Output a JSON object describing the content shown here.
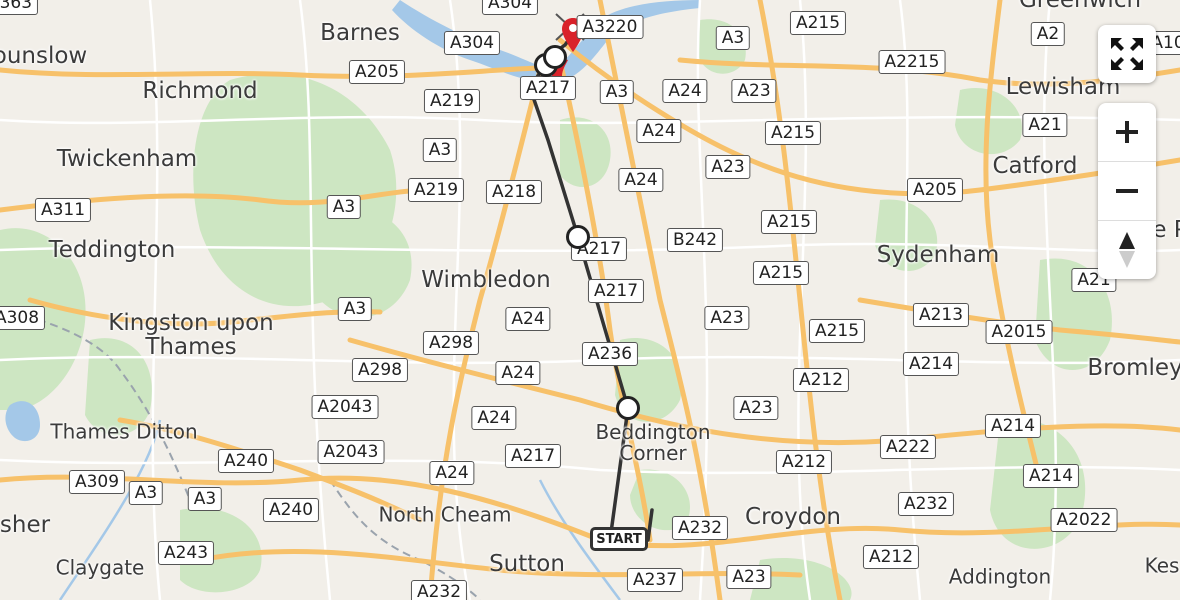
{
  "map": {
    "places": [
      {
        "name": "Barnes",
        "size": "lg"
      },
      {
        "name": "ounslow",
        "size": "lg"
      },
      {
        "name": "Richmond",
        "size": "lg"
      },
      {
        "name": "Twickenham",
        "size": "lg"
      },
      {
        "name": "Teddington",
        "size": "lg"
      },
      {
        "name": "Kingston upon\nThames",
        "size": "lg"
      },
      {
        "name": "Wimbledon",
        "size": "lg"
      },
      {
        "name": "Thames Ditton",
        "size": "sm"
      },
      {
        "name": "North Cheam",
        "size": "sm"
      },
      {
        "name": "Claygate",
        "size": "sm"
      },
      {
        "name": "Sutton",
        "size": "lg"
      },
      {
        "name": "Beddington\nCorner",
        "size": "sm"
      },
      {
        "name": "Croydon",
        "size": "lg"
      },
      {
        "name": "Addington",
        "size": "sm"
      },
      {
        "name": "Kes",
        "size": "sm"
      },
      {
        "name": "Bromley",
        "size": "lg"
      },
      {
        "name": "Sydenham",
        "size": "lg"
      },
      {
        "name": "Catford",
        "size": "lg"
      },
      {
        "name": "Lewisham",
        "size": "lg"
      },
      {
        "name": "Greenwich",
        "size": "lg"
      },
      {
        "name": "sher",
        "size": "lg"
      },
      {
        "name": "e P",
        "size": "lg"
      }
    ],
    "roads": [
      "A304",
      "A3220",
      "A3",
      "A215",
      "A2",
      "A205",
      "A304",
      "A2215",
      "A217",
      "A219",
      "A3",
      "A24",
      "A23",
      "A215",
      "A24",
      "A21",
      "A3",
      "A219",
      "A218",
      "A24",
      "A23",
      "A205",
      "A311",
      "A3",
      "A217",
      "B242",
      "A215",
      "A215",
      "A21",
      "A217",
      "A23",
      "A215",
      "A213",
      "A2015",
      "A308",
      "A3",
      "A24",
      "A236",
      "A298",
      "A298",
      "A24",
      "A212",
      "A214",
      "A2043",
      "A24",
      "A23",
      "A214",
      "A2043",
      "A240",
      "A24",
      "A217",
      "A222",
      "A212",
      "A309",
      "A3",
      "A3",
      "A240",
      "A232",
      "A214",
      "A232",
      "A2022",
      "A243",
      "A237",
      "A212",
      "A23",
      "A232",
      "A363",
      "A10"
    ],
    "route": {
      "start_label": "START"
    },
    "colors": {
      "land": "#f2efe9",
      "park": "#cde6c2",
      "water": "#a4c8e8",
      "motorway_road": "#f7c16a",
      "route_line": "#333333",
      "destination_marker": "#d9222a"
    }
  },
  "controls": {
    "fullscreen_icon": "fullscreen-icon",
    "zoom_in_icon": "plus-icon",
    "zoom_out_icon": "minus-icon",
    "compass_icon": "compass-icon"
  }
}
